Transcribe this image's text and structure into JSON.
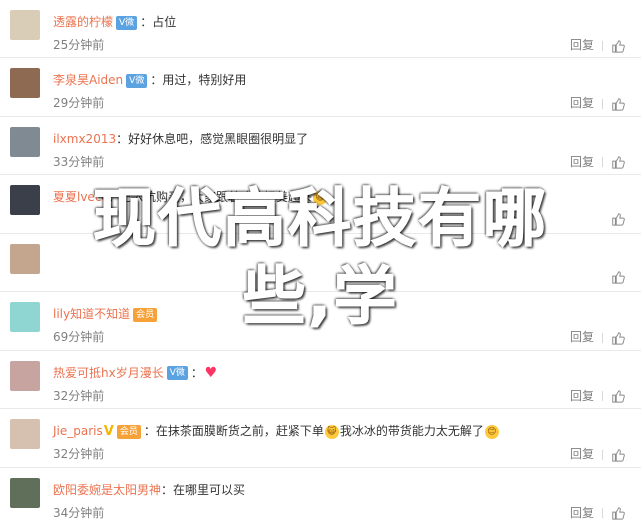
{
  "comments": [
    {
      "user": "透露的柠檬",
      "badges": [
        {
          "type": "vip",
          "label": "V微"
        }
      ],
      "text": "占位",
      "time": "25分钟前",
      "reply": "回复",
      "avatar_color": "#d9cdb7"
    },
    {
      "user": "李泉昊Aiden",
      "badges": [
        {
          "type": "vip",
          "label": "V微"
        }
      ],
      "text": "用过，特别好用",
      "time": "29分钟前",
      "reply": "回复",
      "avatar_color": "#8f6a52"
    },
    {
      "user": "ilxmx2013",
      "badges": [],
      "text": "好好休息吧，感觉黑眼圈很明显了",
      "time": "33分钟前",
      "reply": "回复",
      "avatar_color": "#7f8a93"
    },
    {
      "user": "夏夏lvecc",
      "badges": [],
      "text": "已入坑购买，大家跟着冰冰姐美起来",
      "emoji_end": "😆",
      "time": "",
      "reply": "",
      "avatar_color": "#3a3f4a"
    },
    {
      "user": "",
      "badges": [],
      "text": "",
      "time": "",
      "reply": "",
      "avatar_color": "#c4a58e"
    },
    {
      "user": "lily知道不知道",
      "badges": [
        {
          "type": "member",
          "label": "会员"
        }
      ],
      "text": "",
      "time": "69分钟前",
      "reply": "回复",
      "avatar_color": "#8fd6d2"
    },
    {
      "user": "热爱可抵hx岁月漫长",
      "badges": [
        {
          "type": "vip",
          "label": "V微"
        }
      ],
      "text": "",
      "emoji_end": "♥",
      "time": "32分钟前",
      "reply": "回复",
      "avatar_color": "#c7a4a0"
    },
    {
      "user": "Jie_paris",
      "badges": [
        {
          "type": "vmark",
          "label": "V"
        },
        {
          "type": "member",
          "label": "会员"
        }
      ],
      "text": "在抹茶面膜断货之前，赶紧下单",
      "mid_emoji": "😺",
      "text2": "我冰冰的带货能力太无解了",
      "emoji_end": "😊",
      "time": "32分钟前",
      "reply": "回复",
      "avatar_color": "#d6c1b0"
    },
    {
      "user": "欧阳委婉是太阳男神",
      "badges": [],
      "text": "在哪里可以买",
      "time": "34分钟前",
      "reply": "回复",
      "avatar_color": "#5f6f5a"
    }
  ],
  "overlay": {
    "line1": "现代高科技有哪",
    "line2": "些,学"
  }
}
